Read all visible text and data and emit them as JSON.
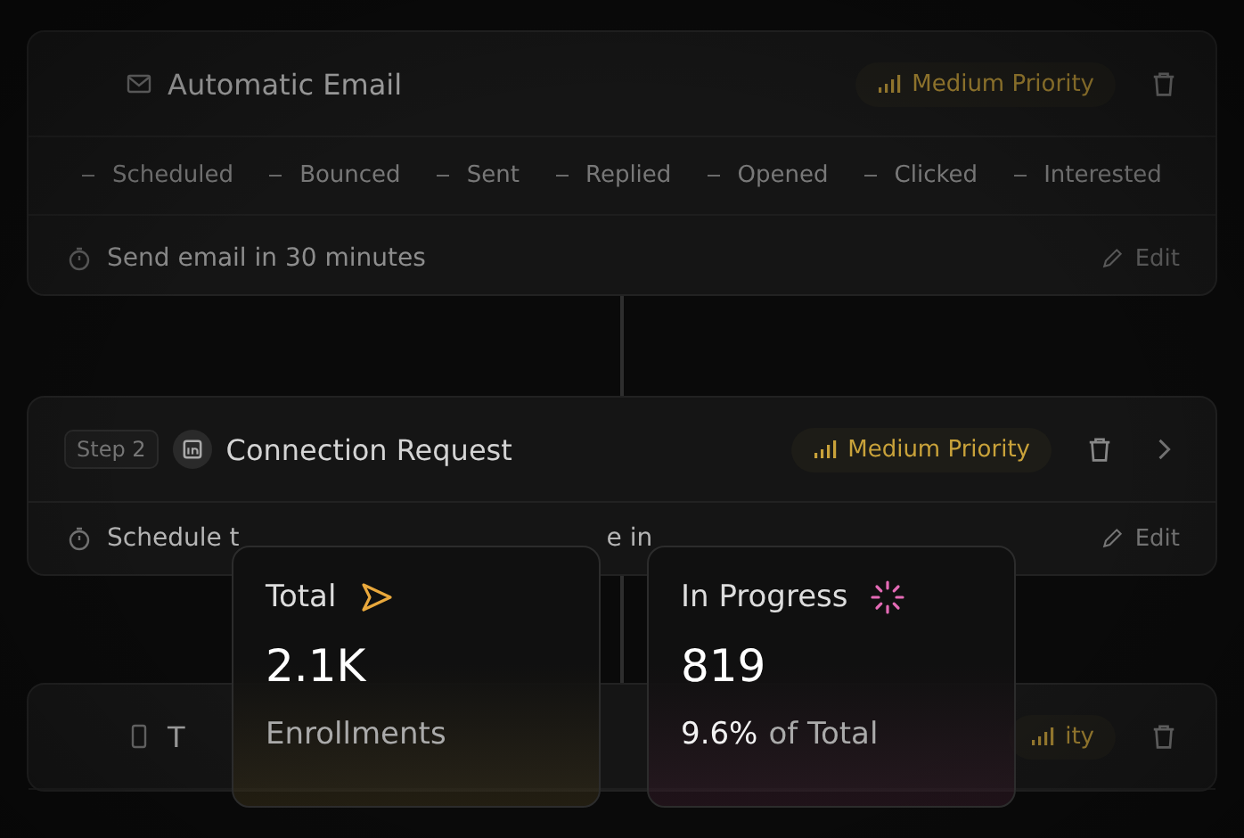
{
  "steps": [
    {
      "title": "Automatic Email",
      "kind": "email",
      "priority": "Medium Priority",
      "stages": [
        "Scheduled",
        "Bounced",
        "Sent",
        "Replied",
        "Opened",
        "Clicked",
        "Interested"
      ],
      "schedule": [
        "Send email in 30 minutes"
      ],
      "edit": "Edit",
      "fade": true
    },
    {
      "badge": "Step 2",
      "title": "Connection Request",
      "kind": "linkedin",
      "priority": "Medium Priority",
      "schedule": [
        "Schedule t",
        "e in"
      ],
      "edit": "Edit",
      "fade": false
    },
    {
      "title": "T",
      "kind": "phone",
      "priority": "ity",
      "fade": true
    }
  ],
  "stats": [
    {
      "label": "Total",
      "kind": "total",
      "value": "2.1K",
      "caption": "Enrollments"
    },
    {
      "label": "In Progress",
      "kind": "progress",
      "value": "819",
      "caption_strong": "9.6%",
      "caption": "of Total"
    }
  ]
}
